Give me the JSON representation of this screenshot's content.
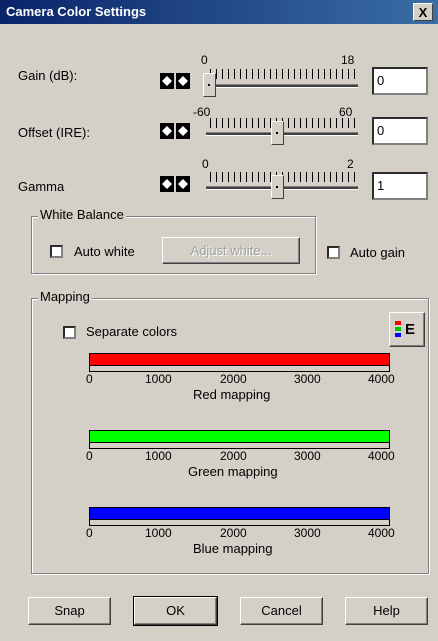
{
  "window": {
    "title": "Camera Color Settings",
    "close_glyph": "X"
  },
  "gain": {
    "label": "Gain (dB):",
    "min": "0",
    "max": "18",
    "value": "0",
    "slider_fraction": 0.0
  },
  "offset": {
    "label": "Offset (IRE):",
    "min": "-60",
    "max": "60",
    "value": "0",
    "slider_fraction": 0.5
  },
  "gamma": {
    "label": "Gamma",
    "min": "0",
    "max": "2",
    "value": "1",
    "slider_fraction": 0.5
  },
  "white_balance": {
    "legend": "White Balance",
    "auto_white_label": "Auto white",
    "auto_white_checked": false,
    "adjust_white_label": "Adjust white..."
  },
  "auto_gain": {
    "label": "Auto gain",
    "checked": false
  },
  "mapping": {
    "legend": "Mapping",
    "separate_colors_label": "Separate colors",
    "separate_colors_checked": false,
    "e_button_label": "E",
    "ticks": [
      "0",
      "1000",
      "2000",
      "3000",
      "4000"
    ],
    "bars": [
      {
        "label": "Red mapping",
        "color": "#ff0000"
      },
      {
        "label": "Green mapping",
        "color": "#00ff00"
      },
      {
        "label": "Blue mapping",
        "color": "#0000ff"
      }
    ]
  },
  "buttons": {
    "snap": "Snap",
    "ok": "OK",
    "cancel": "Cancel",
    "help": "Help"
  }
}
